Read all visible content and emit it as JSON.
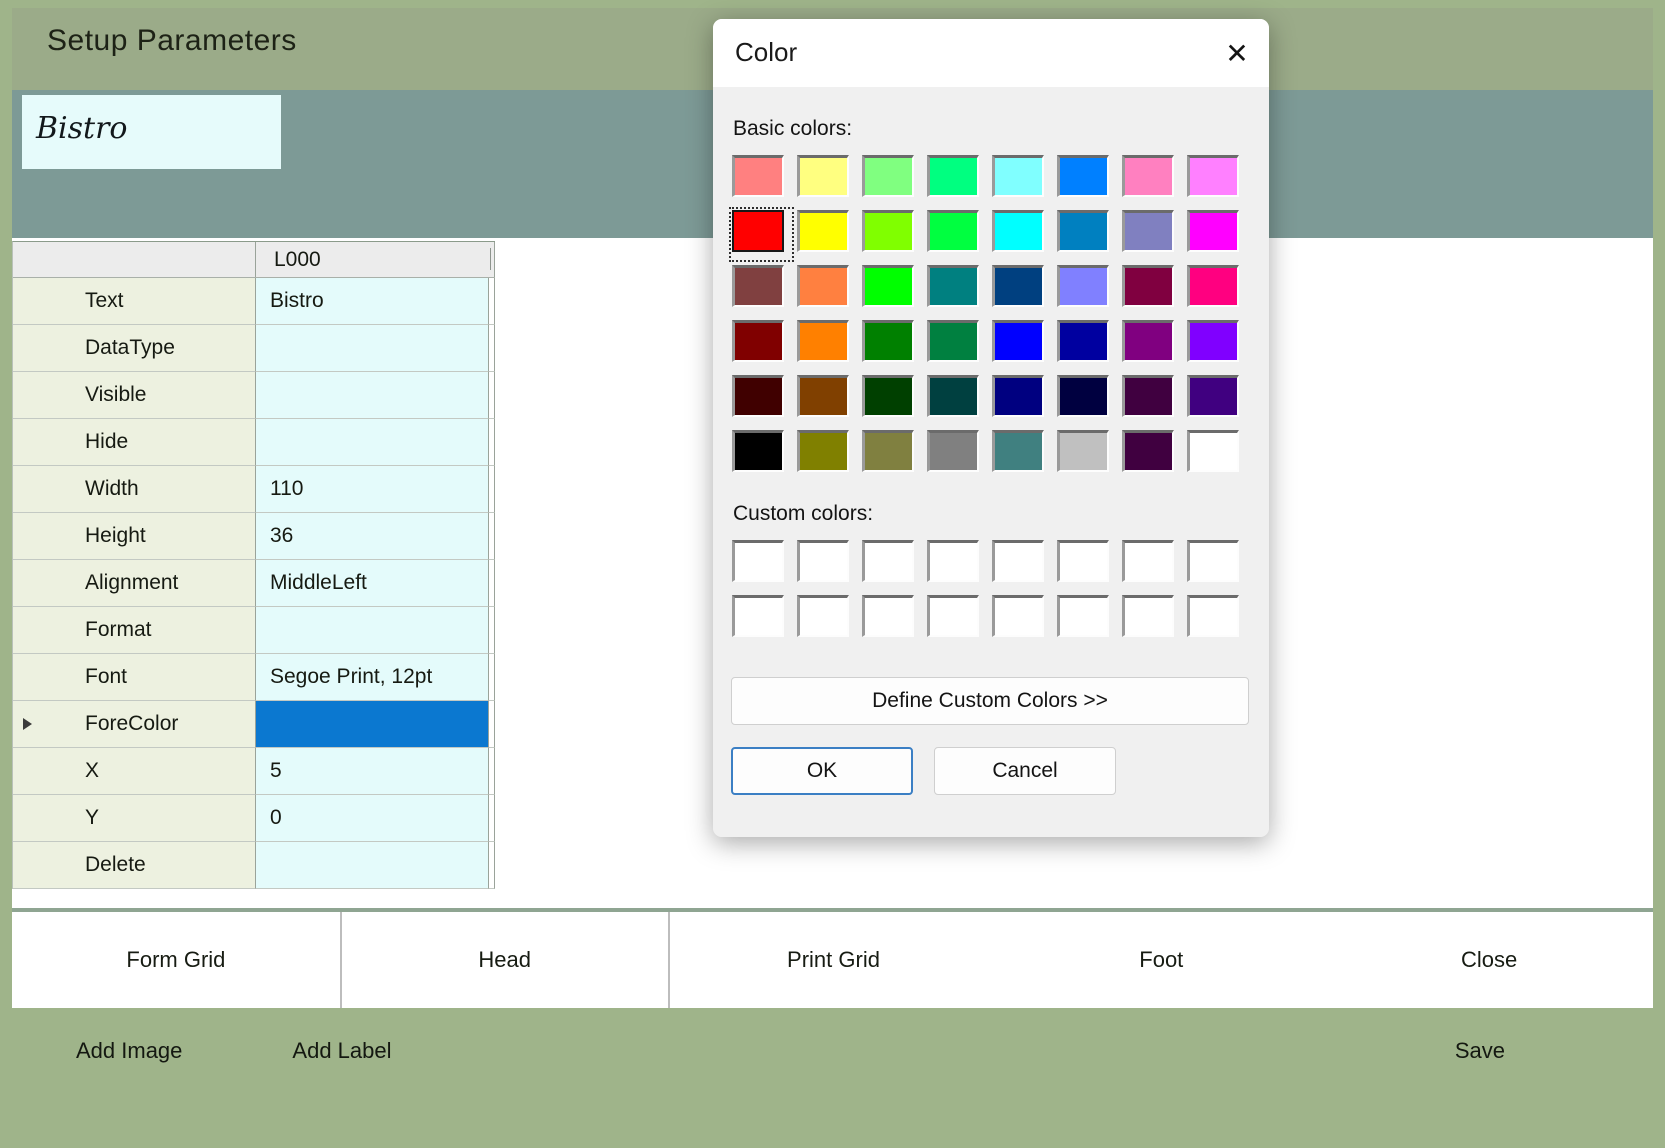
{
  "window": {
    "title": "Setup Parameters",
    "frame_color": "#9fb48a",
    "title_bar_color": "#9bab89",
    "preview_band_color": "#7d9a96"
  },
  "preview": {
    "label_text": "Bistro",
    "label_background": "#e6fbfb"
  },
  "property_grid": {
    "header": {
      "name_column": "",
      "value_column": "L000"
    },
    "rows": [
      {
        "name": "Text",
        "value": "Bistro",
        "selected": false,
        "type": "text"
      },
      {
        "name": "DataType",
        "value": "",
        "selected": false,
        "type": "text"
      },
      {
        "name": "Visible",
        "value": "",
        "selected": false,
        "type": "text"
      },
      {
        "name": "Hide",
        "value": "",
        "selected": false,
        "type": "text"
      },
      {
        "name": "Width",
        "value": "110",
        "selected": false,
        "type": "text"
      },
      {
        "name": "Height",
        "value": "36",
        "selected": false,
        "type": "text"
      },
      {
        "name": "Alignment",
        "value": "MiddleLeft",
        "selected": false,
        "type": "text"
      },
      {
        "name": "Format",
        "value": "",
        "selected": false,
        "type": "text"
      },
      {
        "name": "Font",
        "value": "Segoe Print, 12pt",
        "selected": false,
        "type": "text"
      },
      {
        "name": "ForeColor",
        "value": "",
        "selected": true,
        "type": "color",
        "swatch": "#0b78d0"
      },
      {
        "name": "X",
        "value": "5",
        "selected": false,
        "type": "text"
      },
      {
        "name": "Y",
        "value": "0",
        "selected": false,
        "type": "text"
      },
      {
        "name": "Delete",
        "value": "",
        "selected": false,
        "type": "text"
      }
    ]
  },
  "tabs": [
    {
      "label": "Form Grid",
      "active": false
    },
    {
      "label": "Head",
      "active": true
    },
    {
      "label": "Print Grid",
      "active": false
    },
    {
      "label": "Foot",
      "active": false
    },
    {
      "label": "Close",
      "active": false
    }
  ],
  "action_bar": {
    "add_image_label": "Add Image",
    "add_label_label": "Add Label",
    "save_label": "Save",
    "background": "#9fb48a"
  },
  "color_dialog": {
    "title": "Color",
    "close_icon": "close-icon",
    "close_glyph": "✕",
    "basic_colors_label": "Basic colors:",
    "custom_colors_label": "Custom colors:",
    "define_custom_label": "Define Custom Colors >>",
    "ok_label": "OK",
    "cancel_label": "Cancel",
    "selected_index": 8,
    "basic_colors": [
      "#ff8080",
      "#ffff80",
      "#80ff80",
      "#00ff80",
      "#80ffff",
      "#0080ff",
      "#ff80c0",
      "#ff80ff",
      "#ff0000",
      "#ffff00",
      "#80ff00",
      "#00ff40",
      "#00ffff",
      "#0080c0",
      "#8080c0",
      "#ff00ff",
      "#804040",
      "#ff8040",
      "#00ff00",
      "#008080",
      "#004080",
      "#8080ff",
      "#800040",
      "#ff0080",
      "#800000",
      "#ff8000",
      "#008000",
      "#008040",
      "#0000ff",
      "#0000a0",
      "#800080",
      "#8000ff",
      "#400000",
      "#804000",
      "#004000",
      "#004040",
      "#000080",
      "#000040",
      "#400040",
      "#400080",
      "#000000",
      "#808000",
      "#808040",
      "#808080",
      "#408080",
      "#c0c0c0",
      "#400040",
      "#ffffff"
    ],
    "custom_colors": [
      "#ffffff",
      "#ffffff",
      "#ffffff",
      "#ffffff",
      "#ffffff",
      "#ffffff",
      "#ffffff",
      "#ffffff",
      "#ffffff",
      "#ffffff",
      "#ffffff",
      "#ffffff",
      "#ffffff",
      "#ffffff",
      "#ffffff",
      "#ffffff"
    ]
  }
}
